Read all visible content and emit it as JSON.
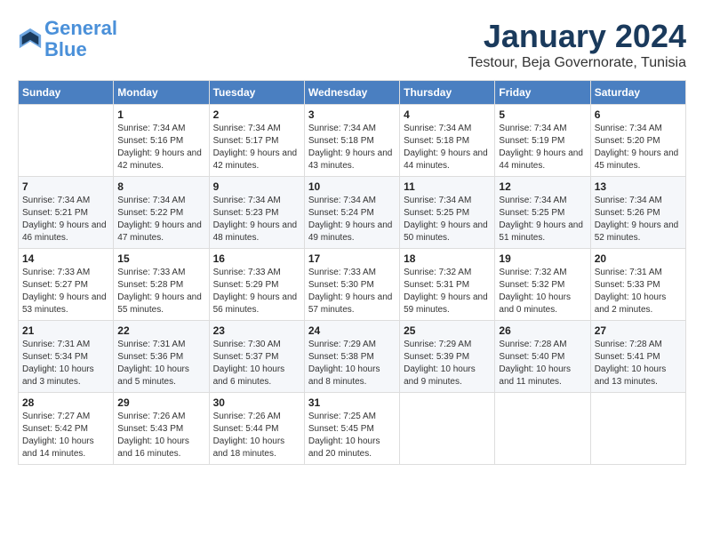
{
  "header": {
    "logo_line1": "General",
    "logo_line2": "Blue",
    "title": "January 2024",
    "subtitle": "Testour, Beja Governorate, Tunisia"
  },
  "calendar": {
    "days_of_week": [
      "Sunday",
      "Monday",
      "Tuesday",
      "Wednesday",
      "Thursday",
      "Friday",
      "Saturday"
    ],
    "weeks": [
      [
        {
          "day": "",
          "sunrise": "",
          "sunset": "",
          "daylight": "",
          "empty": true
        },
        {
          "day": "1",
          "sunrise": "Sunrise: 7:34 AM",
          "sunset": "Sunset: 5:16 PM",
          "daylight": "Daylight: 9 hours and 42 minutes."
        },
        {
          "day": "2",
          "sunrise": "Sunrise: 7:34 AM",
          "sunset": "Sunset: 5:17 PM",
          "daylight": "Daylight: 9 hours and 42 minutes."
        },
        {
          "day": "3",
          "sunrise": "Sunrise: 7:34 AM",
          "sunset": "Sunset: 5:18 PM",
          "daylight": "Daylight: 9 hours and 43 minutes."
        },
        {
          "day": "4",
          "sunrise": "Sunrise: 7:34 AM",
          "sunset": "Sunset: 5:18 PM",
          "daylight": "Daylight: 9 hours and 44 minutes."
        },
        {
          "day": "5",
          "sunrise": "Sunrise: 7:34 AM",
          "sunset": "Sunset: 5:19 PM",
          "daylight": "Daylight: 9 hours and 44 minutes."
        },
        {
          "day": "6",
          "sunrise": "Sunrise: 7:34 AM",
          "sunset": "Sunset: 5:20 PM",
          "daylight": "Daylight: 9 hours and 45 minutes."
        }
      ],
      [
        {
          "day": "7",
          "sunrise": "Sunrise: 7:34 AM",
          "sunset": "Sunset: 5:21 PM",
          "daylight": "Daylight: 9 hours and 46 minutes."
        },
        {
          "day": "8",
          "sunrise": "Sunrise: 7:34 AM",
          "sunset": "Sunset: 5:22 PM",
          "daylight": "Daylight: 9 hours and 47 minutes."
        },
        {
          "day": "9",
          "sunrise": "Sunrise: 7:34 AM",
          "sunset": "Sunset: 5:23 PM",
          "daylight": "Daylight: 9 hours and 48 minutes."
        },
        {
          "day": "10",
          "sunrise": "Sunrise: 7:34 AM",
          "sunset": "Sunset: 5:24 PM",
          "daylight": "Daylight: 9 hours and 49 minutes."
        },
        {
          "day": "11",
          "sunrise": "Sunrise: 7:34 AM",
          "sunset": "Sunset: 5:25 PM",
          "daylight": "Daylight: 9 hours and 50 minutes."
        },
        {
          "day": "12",
          "sunrise": "Sunrise: 7:34 AM",
          "sunset": "Sunset: 5:25 PM",
          "daylight": "Daylight: 9 hours and 51 minutes."
        },
        {
          "day": "13",
          "sunrise": "Sunrise: 7:34 AM",
          "sunset": "Sunset: 5:26 PM",
          "daylight": "Daylight: 9 hours and 52 minutes."
        }
      ],
      [
        {
          "day": "14",
          "sunrise": "Sunrise: 7:33 AM",
          "sunset": "Sunset: 5:27 PM",
          "daylight": "Daylight: 9 hours and 53 minutes."
        },
        {
          "day": "15",
          "sunrise": "Sunrise: 7:33 AM",
          "sunset": "Sunset: 5:28 PM",
          "daylight": "Daylight: 9 hours and 55 minutes."
        },
        {
          "day": "16",
          "sunrise": "Sunrise: 7:33 AM",
          "sunset": "Sunset: 5:29 PM",
          "daylight": "Daylight: 9 hours and 56 minutes."
        },
        {
          "day": "17",
          "sunrise": "Sunrise: 7:33 AM",
          "sunset": "Sunset: 5:30 PM",
          "daylight": "Daylight: 9 hours and 57 minutes."
        },
        {
          "day": "18",
          "sunrise": "Sunrise: 7:32 AM",
          "sunset": "Sunset: 5:31 PM",
          "daylight": "Daylight: 9 hours and 59 minutes."
        },
        {
          "day": "19",
          "sunrise": "Sunrise: 7:32 AM",
          "sunset": "Sunset: 5:32 PM",
          "daylight": "Daylight: 10 hours and 0 minutes."
        },
        {
          "day": "20",
          "sunrise": "Sunrise: 7:31 AM",
          "sunset": "Sunset: 5:33 PM",
          "daylight": "Daylight: 10 hours and 2 minutes."
        }
      ],
      [
        {
          "day": "21",
          "sunrise": "Sunrise: 7:31 AM",
          "sunset": "Sunset: 5:34 PM",
          "daylight": "Daylight: 10 hours and 3 minutes."
        },
        {
          "day": "22",
          "sunrise": "Sunrise: 7:31 AM",
          "sunset": "Sunset: 5:36 PM",
          "daylight": "Daylight: 10 hours and 5 minutes."
        },
        {
          "day": "23",
          "sunrise": "Sunrise: 7:30 AM",
          "sunset": "Sunset: 5:37 PM",
          "daylight": "Daylight: 10 hours and 6 minutes."
        },
        {
          "day": "24",
          "sunrise": "Sunrise: 7:29 AM",
          "sunset": "Sunset: 5:38 PM",
          "daylight": "Daylight: 10 hours and 8 minutes."
        },
        {
          "day": "25",
          "sunrise": "Sunrise: 7:29 AM",
          "sunset": "Sunset: 5:39 PM",
          "daylight": "Daylight: 10 hours and 9 minutes."
        },
        {
          "day": "26",
          "sunrise": "Sunrise: 7:28 AM",
          "sunset": "Sunset: 5:40 PM",
          "daylight": "Daylight: 10 hours and 11 minutes."
        },
        {
          "day": "27",
          "sunrise": "Sunrise: 7:28 AM",
          "sunset": "Sunset: 5:41 PM",
          "daylight": "Daylight: 10 hours and 13 minutes."
        }
      ],
      [
        {
          "day": "28",
          "sunrise": "Sunrise: 7:27 AM",
          "sunset": "Sunset: 5:42 PM",
          "daylight": "Daylight: 10 hours and 14 minutes."
        },
        {
          "day": "29",
          "sunrise": "Sunrise: 7:26 AM",
          "sunset": "Sunset: 5:43 PM",
          "daylight": "Daylight: 10 hours and 16 minutes."
        },
        {
          "day": "30",
          "sunrise": "Sunrise: 7:26 AM",
          "sunset": "Sunset: 5:44 PM",
          "daylight": "Daylight: 10 hours and 18 minutes."
        },
        {
          "day": "31",
          "sunrise": "Sunrise: 7:25 AM",
          "sunset": "Sunset: 5:45 PM",
          "daylight": "Daylight: 10 hours and 20 minutes."
        },
        {
          "day": "",
          "sunrise": "",
          "sunset": "",
          "daylight": "",
          "empty": true
        },
        {
          "day": "",
          "sunrise": "",
          "sunset": "",
          "daylight": "",
          "empty": true
        },
        {
          "day": "",
          "sunrise": "",
          "sunset": "",
          "daylight": "",
          "empty": true
        }
      ]
    ]
  }
}
